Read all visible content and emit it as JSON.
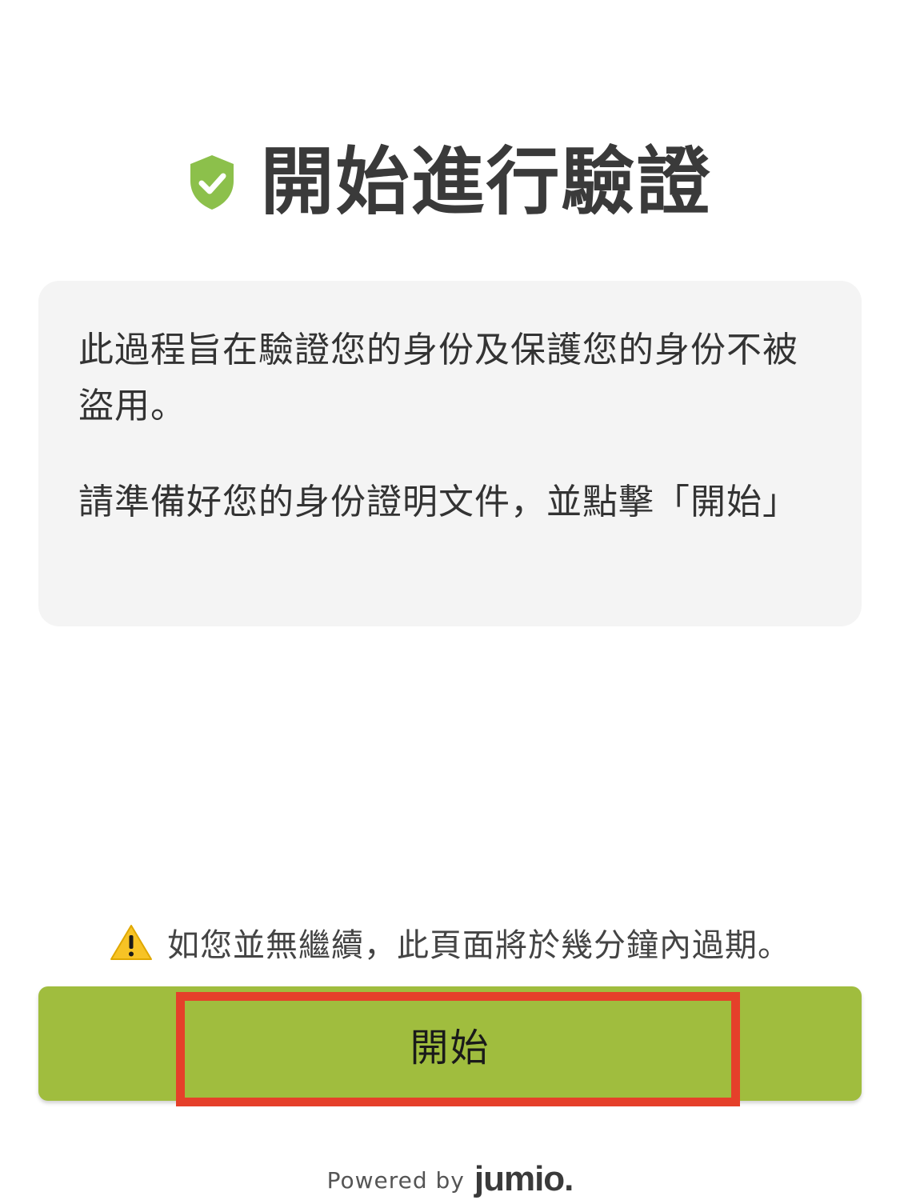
{
  "header": {
    "title": "開始進行驗證",
    "icon": "shield-check-icon",
    "icon_color": "#8cc04b"
  },
  "info_card": {
    "paragraph_1": "此過程旨在驗證您的身份及保護您的身份不被盜用。",
    "paragraph_2": "請準備好您的身份證明文件，並點擊「開始」"
  },
  "warning": {
    "icon": "warning-icon",
    "text": "如您並無繼續，此頁面將於幾分鐘內過期。"
  },
  "start_button": {
    "label": "開始",
    "color": "#a0bd3e"
  },
  "highlight": {
    "color": "#e5402a"
  },
  "footer": {
    "powered_by": "Powered by",
    "brand": "jumio."
  }
}
